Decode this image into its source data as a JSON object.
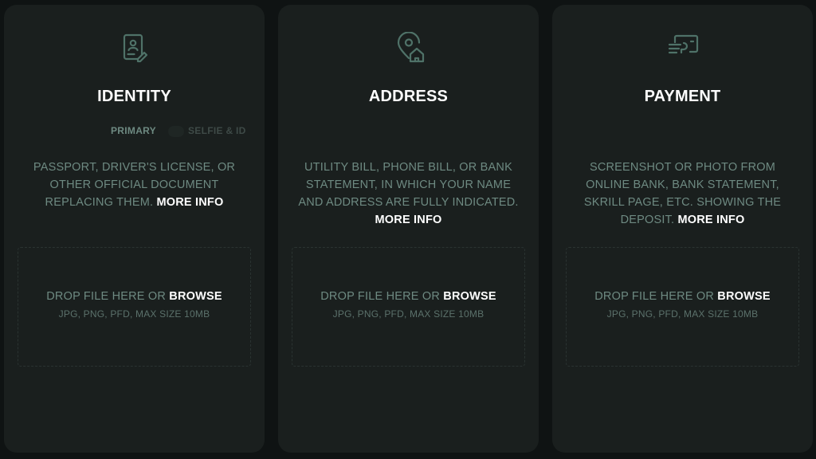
{
  "colors": {
    "background": "#0f1313",
    "card": "#1a1f1e",
    "muted_text": "#6e8a82",
    "accent_icon": "#4f7268",
    "highlight": "#ffffff"
  },
  "cards": [
    {
      "icon": "id-card-icon",
      "title": "IDENTITY",
      "toggle": {
        "primary": "PRIMARY",
        "secondary": "SELFIE & ID"
      },
      "description": "PASSPORT, DRIVER'S LICENSE, OR OTHER OFFICIAL DOCUMENT REPLACING THEM.",
      "more_info": "MORE INFO",
      "drop_text": "DROP FILE HERE OR",
      "browse": "BROWSE",
      "hint": "JPG, PNG, PFD, MAX SIZE 10MB"
    },
    {
      "icon": "location-home-icon",
      "title": "ADDRESS",
      "description": "UTILITY BILL, PHONE BILL, OR BANK STATEMENT, IN WHICH YOUR NAME AND ADDRESS ARE FULLY INDICATED.",
      "more_info": "MORE INFO",
      "drop_text": "DROP FILE HERE OR",
      "browse": "BROWSE",
      "hint": "JPG, PNG, PFD, MAX SIZE 10MB"
    },
    {
      "icon": "payment-card-icon",
      "title": "PAYMENT",
      "description": "SCREENSHOT OR PHOTO FROM ONLINE BANK, BANK STATEMENT, SKRILL PAGE, ETC. SHOWING THE DEPOSIT.",
      "more_info": "MORE INFO",
      "drop_text": "DROP FILE HERE OR",
      "browse": "BROWSE",
      "hint": "JPG, PNG, PFD, MAX SIZE 10MB"
    }
  ]
}
